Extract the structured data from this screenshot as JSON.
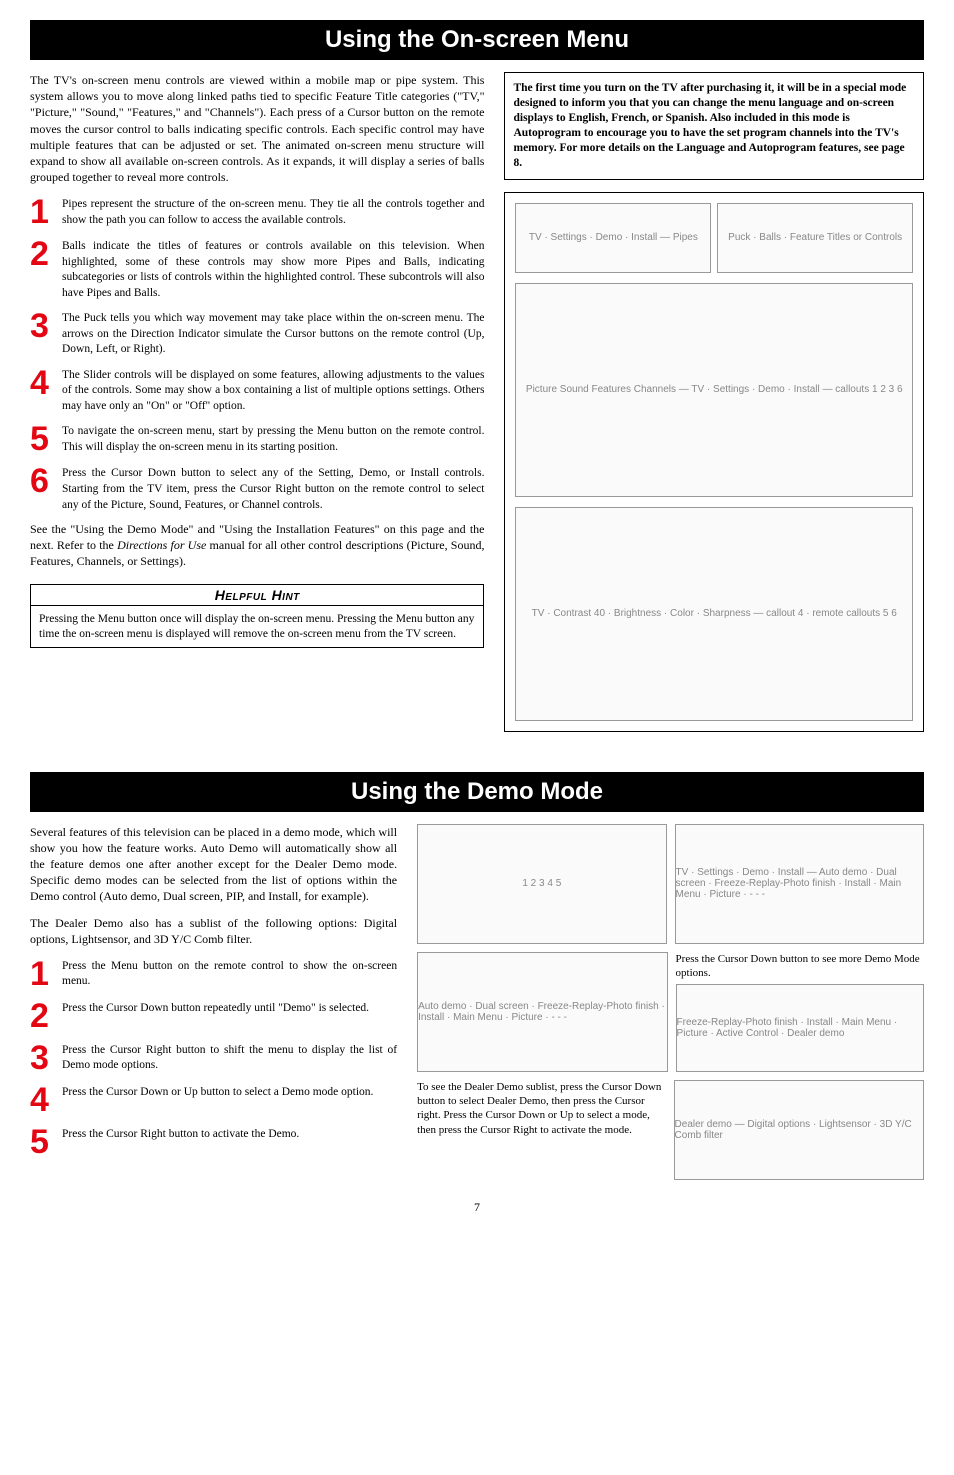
{
  "section1": {
    "title": "Using the On-screen Menu",
    "intro": "The TV's on-screen menu controls are viewed within a mobile map or pipe system. This system allows you to move along linked paths tied to specific Feature Title categories (\"TV,\" \"Picture,\" \"Sound,\" \"Features,\" and \"Channels\"). Each press of a Cursor button on the remote moves the cursor control to balls indicating specific controls. Each specific control may have multiple features that can be adjusted or set. The animated on-screen menu structure will expand to show all available on-screen controls. As it expands, it will display a series of balls grouped together to reveal more controls.",
    "steps": [
      {
        "num": "1",
        "text": "Pipes represent the structure of the on-screen menu. They tie all the controls together and show the path you can follow to access the available controls."
      },
      {
        "num": "2",
        "text": "Balls indicate the titles of features or controls available on this television. When highlighted, some of these controls may show more Pipes and Balls, indicating subcategories or lists of controls within the highlighted control. These subcontrols will also have Pipes and Balls."
      },
      {
        "num": "3",
        "text": "The Puck tells you which way movement may take place within the on-screen menu. The arrows on the Direction Indicator simulate the Cursor buttons on the remote control (Up, Down, Left, or Right)."
      },
      {
        "num": "4",
        "text": "The Slider controls will be displayed on some features, allowing adjustments to the values of the controls. Some may show a box containing a list of multiple options settings. Others may have only an \"On\" or \"Off\" option."
      },
      {
        "num": "5",
        "text": "To navigate the on-screen menu, start by pressing the Menu button on the remote control. This will display the on-screen menu in its starting position."
      },
      {
        "num": "6",
        "text": "Press the Cursor Down button to select any of the Setting, Demo, or Install controls. Starting from the TV item, press the Cursor Right button on the remote control to select any of the Picture, Sound, Features, or Channel controls."
      }
    ],
    "closing_a": "See the \"Using the Demo Mode\" and \"Using the Installation Features\" on this page and the next. Refer to the ",
    "closing_em": "Directions for Use",
    "closing_b": " manual for all other control descriptions (Picture, Sound, Features, Channels, or Settings).",
    "hint_title": "Helpful Hint",
    "hint_body": "Pressing the Menu button once will display the on-screen menu. Pressing the Menu button any time the on-screen menu is displayed will remove the on-screen menu from the TV screen.",
    "callout": "The first time you turn on the TV after purchasing it, it will be in a special mode designed to inform you that you can change the menu language and on-screen displays to English, French, or Spanish. Also included in this mode is Autoprogram to encourage you to have the set program channels into the TV's memory. For more details on the Language and Autoprogram features, see page 8.",
    "diagram_labels": {
      "top_left": "TV · Settings · Demo · Install — Pipes",
      "top_right": "Puck · Balls · Feature Titles or Controls",
      "mid": "Picture Sound Features Channels — TV · Settings · Demo · Install — callouts 1 2 3 6",
      "bottom": "TV · Contrast 40 · Brightness · Color · Sharpness — callout 4 · remote callouts 5 6"
    }
  },
  "section2": {
    "title": "Using the Demo Mode",
    "intro": "Several features of this television can be placed in a demo mode, which will show you how the feature works. Auto Demo will automatically show all the feature demos one after another except for the Dealer Demo mode. Specific demo modes can be selected from the list of options within the Demo control (Auto demo, Dual screen, PIP, and Install, for example).",
    "intro2": "The Dealer Demo also has a sublist of the following options: Digital options, Lightsensor, and 3D Y/C Comb filter.",
    "steps": [
      {
        "num": "1",
        "text": "Press the Menu button on the remote control to show the on-screen menu."
      },
      {
        "num": "2",
        "text": "Press the Cursor Down button repeatedly until \"Demo\" is selected."
      },
      {
        "num": "3",
        "text": "Press the Cursor Right button to shift the menu to display the list of Demo mode options."
      },
      {
        "num": "4",
        "text": "Press the Cursor Down or Up button to select a Demo mode option."
      },
      {
        "num": "5",
        "text": "Press the Cursor Right button to activate the Demo."
      }
    ],
    "diagram_labels": {
      "top_right_menu": "TV · Settings · Demo · Install — Auto demo · Dual screen · Freeze-Replay-Photo finish · Install · Main Menu · Picture · - - -",
      "remote_callouts": "1 2 3 4 5",
      "right_caption": "Press the Cursor Down button to see more Demo Mode options.",
      "demo_list": "Auto demo · Dual screen · Freeze-Replay-Photo finish · Install · Main Menu · Picture · - - -",
      "demo_list2": "Freeze-Replay-Photo finish · Install · Main Menu · Picture · Active Control · Dealer demo",
      "dealer_caption": "To see the Dealer Demo sublist, press the Cursor Down button to select Dealer Demo, then press the Cursor right. Press the Cursor Down or Up to select a mode, then press the Cursor Right to activate the mode.",
      "dealer_sub": "Dealer demo — Digital options · Lightsensor · 3D Y/C Comb filter"
    }
  },
  "page_number": "7"
}
